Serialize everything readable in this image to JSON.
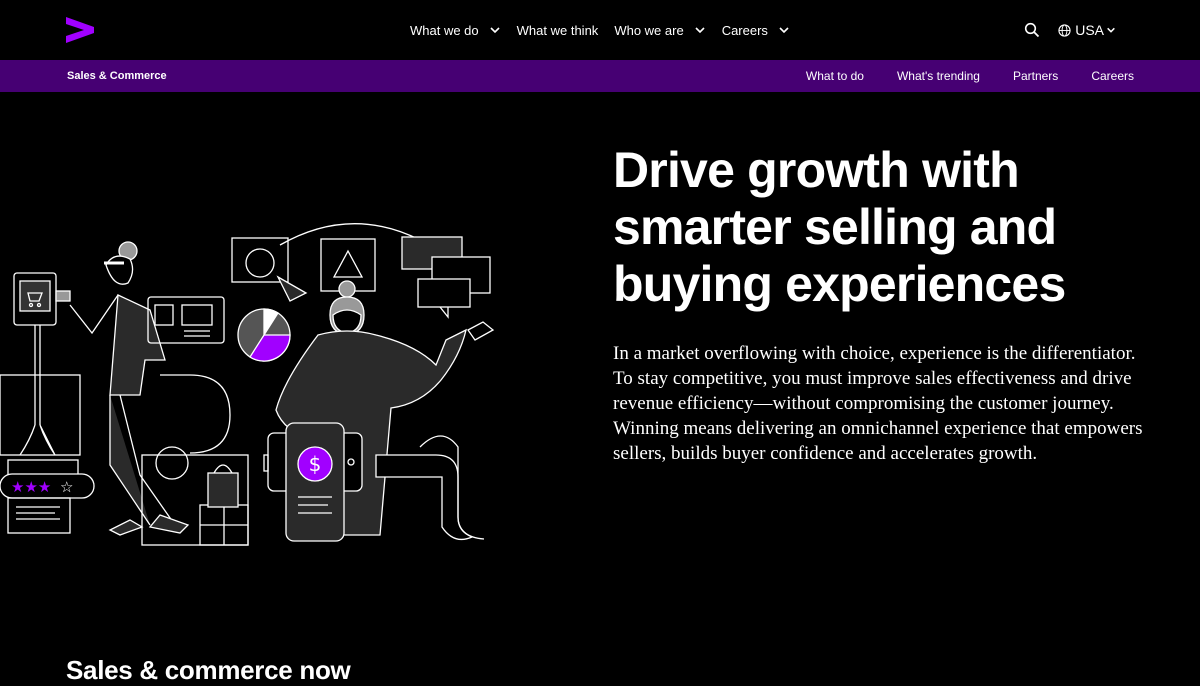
{
  "brand": {
    "accent": "#A100FF",
    "subnav_bg": "#460073",
    "background": "#000000"
  },
  "header": {
    "nav": [
      {
        "label": "What we do",
        "has_dropdown": true
      },
      {
        "label": "What we think",
        "has_dropdown": false
      },
      {
        "label": "Who we are",
        "has_dropdown": true
      },
      {
        "label": "Careers",
        "has_dropdown": true
      }
    ],
    "search_icon": "search-icon",
    "location": "USA"
  },
  "subnav": {
    "title": "Sales & Commerce",
    "links": [
      "What to do",
      "What's trending",
      "Partners",
      "Careers"
    ]
  },
  "hero": {
    "headline": "Drive growth with smarter selling and buying experiences",
    "intro": "In a market overflowing with choice, experience is the differentiator. To stay competitive, you must improve sales effectiveness and drive revenue efficiency—without compromising the customer journey. Winning means delivering an omnichannel experience that empowers sellers, builds buyer confidence and accelerates growth.",
    "illustration": {
      "currency_symbol": "$",
      "rating_stars": 3,
      "rating_max": 4
    }
  },
  "section": {
    "title": "Sales & commerce now"
  }
}
